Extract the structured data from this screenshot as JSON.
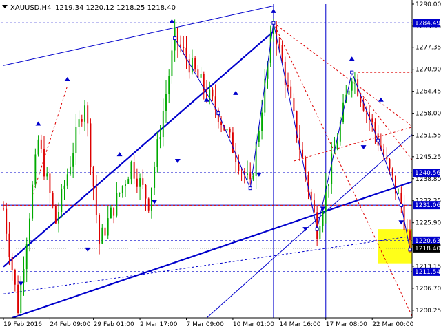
{
  "header": {
    "symbol_timeframe": "XAUUSD,H4",
    "ohlc": "1219.34 1220.12 1218.25 1218.40"
  },
  "colors": {
    "bull": "#00aa00",
    "bear": "#dd0000",
    "trend": "#0000cc",
    "forecast_zone": "#ffff00",
    "axis_bg": "#ffffff",
    "price_badge": "#000000"
  },
  "chart_data": {
    "type": "candlestick",
    "symbol": "XAUUSD",
    "timeframe": "H4",
    "ylim": [
      1198,
      1290
    ],
    "y_ticks": [
      "1290.00",
      "1283.55",
      "1277.35",
      "1270.90",
      "1264.45",
      "1258.00",
      "1251.55",
      "1245.25",
      "1238.80",
      "1232.35",
      "1225.90",
      "1219.45",
      "1213.15",
      "1206.70",
      "1200.25"
    ],
    "y_tick_values": [
      1290.0,
      1283.55,
      1277.35,
      1270.9,
      1264.45,
      1258.0,
      1251.55,
      1245.25,
      1238.8,
      1232.35,
      1225.9,
      1219.45,
      1213.15,
      1206.7,
      1200.25
    ],
    "x_labels": [
      "19 Feb 2016",
      "24 Feb 09:00",
      "29 Feb 01:00",
      "2 Mar 17:00",
      "7 Mar 09:00",
      "10 Mar 01:00",
      "14 Mar 16:00",
      "17 Mar 08:00",
      "22 Mar 00:00"
    ],
    "x_label_bars": [
      0,
      16,
      31,
      47,
      63,
      79,
      95,
      111,
      127
    ],
    "bar_count": 141,
    "price_levels": [
      {
        "label": "1284.49",
        "value": 1284.49,
        "style": "dashed"
      },
      {
        "label": "1240.56",
        "value": 1240.56,
        "style": "dashed"
      },
      {
        "label": "1231.06",
        "value": 1231.06,
        "style": "solid"
      },
      {
        "label": "1220.63",
        "value": 1220.63,
        "style": "dashed"
      },
      {
        "label": "1218.40",
        "value": 1218.4,
        "style": "current"
      },
      {
        "label": "1211.54",
        "value": 1211.54,
        "style": "dashed"
      }
    ],
    "forecast_zone": {
      "bar_start": 129,
      "bar_end": 141,
      "price_high": 1224.0,
      "price_low": 1214.0
    },
    "trendlines": [
      {
        "points": [
          [
            0,
            1213.0
          ],
          [
            93,
            1282.0
          ]
        ],
        "style": "thick"
      },
      {
        "points": [
          [
            3,
            1198.0
          ],
          [
            141,
            1238.0
          ]
        ],
        "style": "thick"
      },
      {
        "points": [
          [
            0,
            1272.0
          ],
          [
            93,
            1289.5
          ]
        ],
        "style": "thin"
      },
      {
        "points": [
          [
            70,
            1198.0
          ],
          [
            141,
            1252.0
          ]
        ],
        "style": "thin"
      },
      {
        "points": [
          [
            0,
            1205.0
          ],
          [
            141,
            1222.0
          ]
        ],
        "style": "thin-dashed"
      },
      {
        "points": [
          [
            93,
            1284.5
          ],
          [
            141,
            1254.0
          ]
        ],
        "style": "red-dashed"
      },
      {
        "points": [
          [
            93,
            1284.5
          ],
          [
            141,
            1198.0
          ]
        ],
        "style": "red-dashed"
      },
      {
        "points": [
          [
            10,
            1234.0
          ],
          [
            22,
            1266.0
          ]
        ],
        "style": "red-dashed"
      },
      {
        "points": [
          [
            122,
            1265.0
          ],
          [
            141,
            1244.0
          ]
        ],
        "style": "red-dashed"
      },
      {
        "points": [
          [
            122,
            1270.0
          ],
          [
            141,
            1270.0
          ]
        ],
        "style": "red-dashed"
      },
      {
        "points": [
          [
            0,
            1231.0
          ],
          [
            141,
            1231.0
          ]
        ],
        "style": "red-dashed"
      },
      {
        "points": [
          [
            100,
            1244.0
          ],
          [
            141,
            1254.0
          ]
        ],
        "style": "red-dashed"
      }
    ],
    "zigzag": [
      [
        59,
        1280.0
      ],
      [
        74,
        1258.0
      ],
      [
        85,
        1236.0
      ],
      [
        93,
        1284.5
      ],
      [
        108,
        1224.0
      ],
      [
        120,
        1270.0
      ],
      [
        129,
        1250.0
      ],
      [
        137,
        1231.0
      ],
      [
        140,
        1218.0
      ]
    ]
  }
}
